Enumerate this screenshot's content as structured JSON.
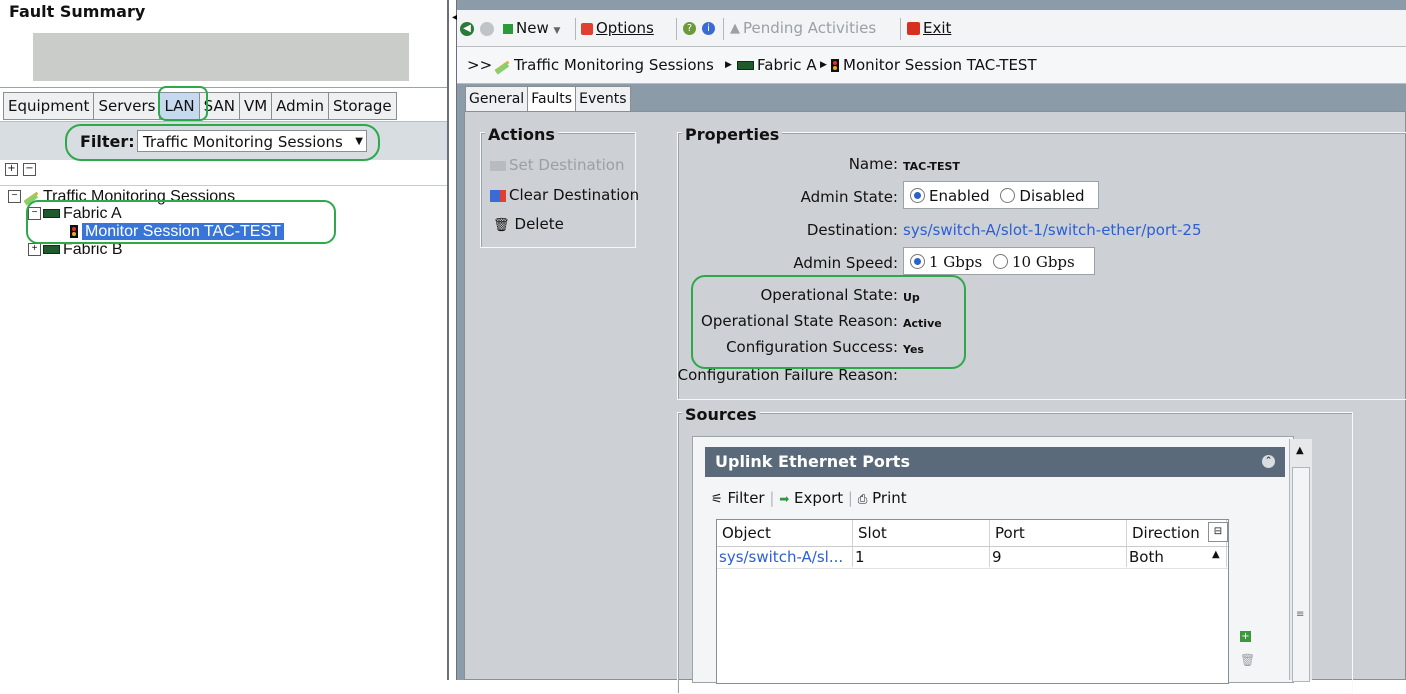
{
  "left": {
    "fault_summary_title": "Fault Summary",
    "nav_tabs": [
      "Equipment",
      "Servers",
      "LAN",
      "SAN",
      "VM",
      "Admin",
      "Storage"
    ],
    "active_tab": "LAN",
    "filter_label": "Filter:",
    "filter_value": "Traffic Monitoring Sessions",
    "tree": {
      "root": "Traffic Monitoring Sessions",
      "fabric_a": "Fabric A",
      "session": "Monitor Session TAC-TEST",
      "fabric_b": "Fabric B"
    }
  },
  "toolbar": {
    "new_label": "New",
    "options_label": "Options",
    "pending_label": "Pending Activities",
    "exit_label": "Exit"
  },
  "breadcrumb": {
    "prefix": ">>",
    "items": [
      "Traffic Monitoring Sessions",
      "Fabric A",
      "Monitor Session TAC-TEST"
    ]
  },
  "content_tabs": [
    "General",
    "Faults",
    "Events"
  ],
  "actions": {
    "legend": "Actions",
    "set_destination": "Set Destination",
    "clear_destination": "Clear Destination",
    "delete": "Delete"
  },
  "properties": {
    "legend": "Properties",
    "name_label": "Name:",
    "name_value": "TAC-TEST",
    "admin_state_label": "Admin State:",
    "admin_state_options": [
      "Enabled",
      "Disabled"
    ],
    "admin_state_selected": "Enabled",
    "destination_label": "Destination:",
    "destination_value": "sys/switch-A/slot-1/switch-ether/port-25",
    "admin_speed_label": "Admin Speed:",
    "admin_speed_options": [
      "1 Gbps",
      "10 Gbps"
    ],
    "admin_speed_selected": "1 Gbps",
    "op_state_label": "Operational State:",
    "op_state_value": "Up",
    "op_reason_label": "Operational State Reason:",
    "op_reason_value": "Active",
    "config_success_label": "Configuration Success:",
    "config_success_value": "Yes",
    "config_failure_label": "Configuration Failure Reason:"
  },
  "sources": {
    "legend": "Sources",
    "panel_title": "Uplink Ethernet Ports",
    "tools": [
      "Filter",
      "Export",
      "Print"
    ],
    "columns": [
      "Object",
      "Slot",
      "Port",
      "Direction"
    ],
    "rows": [
      {
        "object": "sys/switch-A/sl...",
        "slot": "1",
        "port": "9",
        "direction": "Both"
      }
    ]
  },
  "colors": {
    "highlight_green": "#2ea84a",
    "link_blue": "#2a5fd6",
    "selection_blue": "#3875d7",
    "right_bg": "#8c9ba8"
  }
}
